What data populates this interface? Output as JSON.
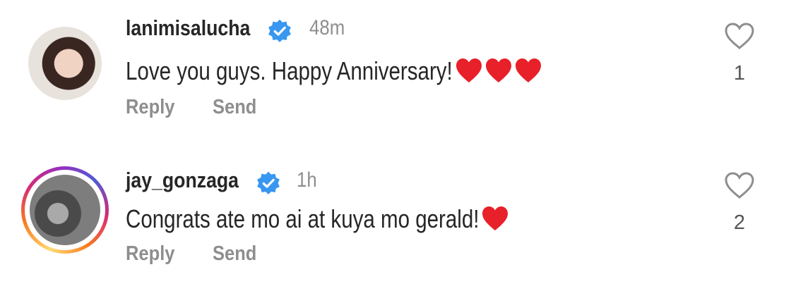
{
  "comments": [
    {
      "username": "lanimisalucha",
      "verified": true,
      "time": "48m",
      "text": "Love you guys. Happy Anniversary!",
      "emoji_hearts": 3,
      "actions": {
        "reply": "Reply",
        "send": "Send"
      },
      "like_count": "1",
      "story_ring": false
    },
    {
      "username": "jay_gonzaga",
      "verified": true,
      "time": "1h",
      "text": "Congrats ate mo ai at kuya mo gerald!",
      "emoji_hearts": 1,
      "actions": {
        "reply": "Reply",
        "send": "Send"
      },
      "like_count": "2",
      "story_ring": true
    }
  ],
  "colors": {
    "verified_badge": "#3897f0",
    "heart_emoji": "#e8202a",
    "secondary_text": "#8e8e8e",
    "primary_text": "#262626"
  },
  "icons": {
    "verified": "verified-badge-icon",
    "like": "heart-outline-icon",
    "emoji": "red-heart-emoji"
  }
}
